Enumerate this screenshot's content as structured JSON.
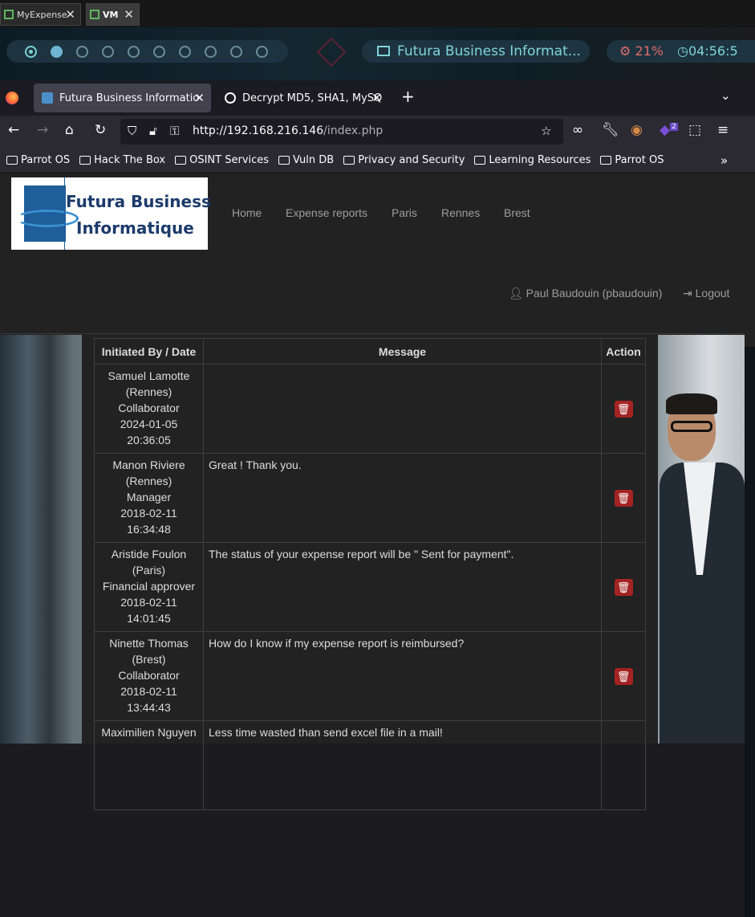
{
  "outer_tabs": [
    {
      "label": "MyExpense"
    },
    {
      "label": "VM"
    }
  ],
  "panel": {
    "window_title": "Futura Business Informat...",
    "cpu": "21%",
    "clock": "04:56:5"
  },
  "browser": {
    "tabs": [
      {
        "label": "Futura Business Informatio"
      },
      {
        "label": "Decrypt MD5, SHA1, MySQ"
      }
    ],
    "url_host": "http://192.168.216.146",
    "url_path": "/index.php",
    "extension_badge": "2",
    "bookmarks": [
      "Parrot OS",
      "Hack The Box",
      "OSINT Services",
      "Vuln DB",
      "Privacy and Security",
      "Learning Resources",
      "Parrot OS"
    ]
  },
  "site": {
    "logo_line1": "Futura Business",
    "logo_line2": "Informatique",
    "menu": [
      "Home",
      "Expense reports",
      "Paris",
      "Rennes",
      "Brest"
    ],
    "user": "Paul Baudouin (pbaudouin)",
    "logout": "Logout"
  },
  "table": {
    "headers": [
      "Initiated By / Date",
      "Message",
      "Action"
    ],
    "rows": [
      {
        "name": "Samuel Lamotte",
        "city": "(Rennes)",
        "role": "Collaborator",
        "date": "2024-01-05",
        "time": "20:36:05",
        "message": ""
      },
      {
        "name": "Manon Riviere",
        "city": "(Rennes)",
        "role": "Manager",
        "date": "2018-02-11",
        "time": "16:34:48",
        "message": "Great ! Thank you."
      },
      {
        "name": "Aristide Foulon",
        "city": "(Paris)",
        "role": "Financial approver",
        "date": "2018-02-11",
        "time": "14:01:45",
        "message": "The status of your expense report will be \" Sent for payment\"."
      },
      {
        "name": "Ninette Thomas",
        "city": "(Brest)",
        "role": "Collaborator",
        "date": "2018-02-11",
        "time": "13:44:43",
        "message": "How do I know if my expense report is reimbursed?"
      },
      {
        "name": "Maximilien Nguyen",
        "city": "",
        "role": "",
        "date": "",
        "time": "",
        "message": "Less time wasted than send excel file in a mail!"
      }
    ]
  }
}
